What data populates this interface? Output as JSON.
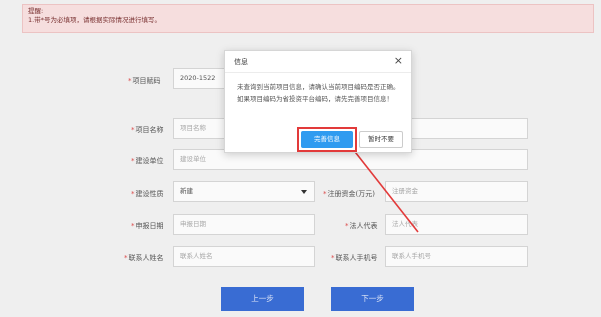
{
  "tip": {
    "line1": "提醒:",
    "line2": "1.带*号为必填项，请根据实际情况进行填写。"
  },
  "form": {
    "project_code": {
      "label": "项目赋码",
      "value": "2020-1522"
    },
    "project_name": {
      "label": "项目名称",
      "placeholder": "项目名称"
    },
    "builder": {
      "label": "建设单位",
      "placeholder": "建设单位"
    },
    "nature": {
      "label": "建设性质",
      "value": "新建"
    },
    "capital": {
      "label": "注册资金(万元)",
      "placeholder": "注册资金"
    },
    "date": {
      "label": "申报日期",
      "placeholder": "申报日期"
    },
    "legal": {
      "label": "法人代表",
      "placeholder": "法人代表"
    },
    "contact": {
      "label": "联系人姓名",
      "placeholder": "联系人姓名"
    },
    "phone": {
      "label": "联系人手机号",
      "placeholder": "联系人手机号"
    }
  },
  "buttons": {
    "prev": "上一步",
    "next": "下一步"
  },
  "dialog": {
    "title": "信息",
    "close": "×",
    "message": "未查询到当前项目信息，请确认当前项目编码是否正确。如果项目编码为省投资平台编码，请先完善项目信息！",
    "primary": "完善信息",
    "secondary": "暂时不要"
  },
  "colors": {
    "primary_button": "#2f9bf0",
    "nav_button": "#3b6fd8",
    "annotation": "#e23a3a",
    "tip_bg": "#fbe3e3"
  }
}
